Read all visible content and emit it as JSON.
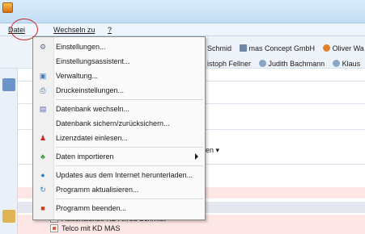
{
  "menubar": {
    "items": [
      "Datei",
      "Wechseln zu",
      "?"
    ]
  },
  "background": {
    "contacts_row_1": [
      {
        "label": "Schmid",
        "icon": "contact-icon",
        "color": "#7a9cc6"
      },
      {
        "label": "mas Concept GmbH",
        "icon": "company-icon",
        "color": "#6f87a6"
      },
      {
        "label": "Oliver Wa",
        "icon": "person-icon",
        "color": "#e0822a"
      }
    ],
    "contacts_row_2": [
      {
        "label": "istoph Fellner",
        "icon": "",
        "color": ""
      },
      {
        "label": "Judith Bachmann",
        "icon": "contact-icon",
        "color": "#8aa6c7"
      },
      {
        "label": "Klaus",
        "icon": "contact-icon",
        "color": "#8aa6c7"
      }
    ],
    "dropdown_fragment": "onen ▾",
    "tree_items": [
      "Außendienst: KD Alfred Schmidt",
      "Telco mit KD MAS"
    ]
  },
  "file_menu": {
    "items": [
      {
        "label": "Einstellungen...",
        "icon": "settings-icon",
        "icon_glyph": "⚙",
        "icon_color": "#5a6f8c",
        "separator_after": false,
        "has_submenu": false
      },
      {
        "label": "Einstellungsassistent...",
        "icon": "",
        "icon_glyph": "",
        "icon_color": "",
        "separator_after": false,
        "has_submenu": false
      },
      {
        "label": "Verwaltung...",
        "icon": "admin-icon",
        "icon_glyph": "▣",
        "icon_color": "#4a7ab5",
        "separator_after": false,
        "has_submenu": false
      },
      {
        "label": "Druckeinstellungen...",
        "icon": "printer-icon",
        "icon_glyph": "⎙",
        "icon_color": "#4b6c9a",
        "separator_after": true,
        "has_submenu": false
      },
      {
        "label": "Datenbank wechseln...",
        "icon": "database-icon",
        "icon_glyph": "▤",
        "icon_color": "#5a62b8",
        "separator_after": false,
        "has_submenu": false
      },
      {
        "label": "Datenbank sichern/zurücksichern...",
        "icon": "",
        "icon_glyph": "",
        "icon_color": "",
        "separator_after": false,
        "has_submenu": false
      },
      {
        "label": "Lizenzdatei einlesen...",
        "icon": "license-icon",
        "icon_glyph": "♟",
        "icon_color": "#c8292b",
        "separator_after": true,
        "has_submenu": false
      },
      {
        "label": "Daten importieren",
        "icon": "import-icon",
        "icon_glyph": "♣",
        "icon_color": "#3e9a3e",
        "separator_after": true,
        "has_submenu": true
      },
      {
        "label": "Updates aus dem Internet herunterladen...",
        "icon": "globe-icon",
        "icon_glyph": "●",
        "icon_color": "#2d7fc6",
        "separator_after": false,
        "has_submenu": false
      },
      {
        "label": "Programm aktualisieren...",
        "icon": "update-icon",
        "icon_glyph": "↻",
        "icon_color": "#2d7fc6",
        "separator_after": true,
        "has_submenu": false
      },
      {
        "label": "Programm beenden...",
        "icon": "exit-icon",
        "icon_glyph": "■",
        "icon_color": "#d9391f",
        "separator_after": false,
        "has_submenu": false
      }
    ]
  },
  "colors": {
    "annotation_circle": "#c8292b",
    "menu_background": "#fafafa",
    "titlebar": "#c9e1f5"
  }
}
